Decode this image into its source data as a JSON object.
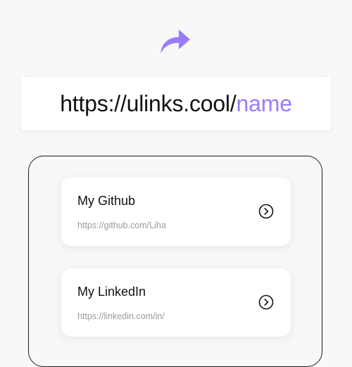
{
  "share": {
    "icon": "share-arrow-icon",
    "color": "#9b7cf6"
  },
  "url_bar": {
    "prefix": "https://ulinks.cool/",
    "suffix": "name",
    "accent_color": "#9b7cf6"
  },
  "links": [
    {
      "title": "My Github",
      "url": "https://github.com/Liha",
      "icon": "chevron-right-circle-icon"
    },
    {
      "title": "My LinkedIn",
      "url": "https://linkedin.com/in/",
      "icon": "chevron-right-circle-icon"
    }
  ]
}
